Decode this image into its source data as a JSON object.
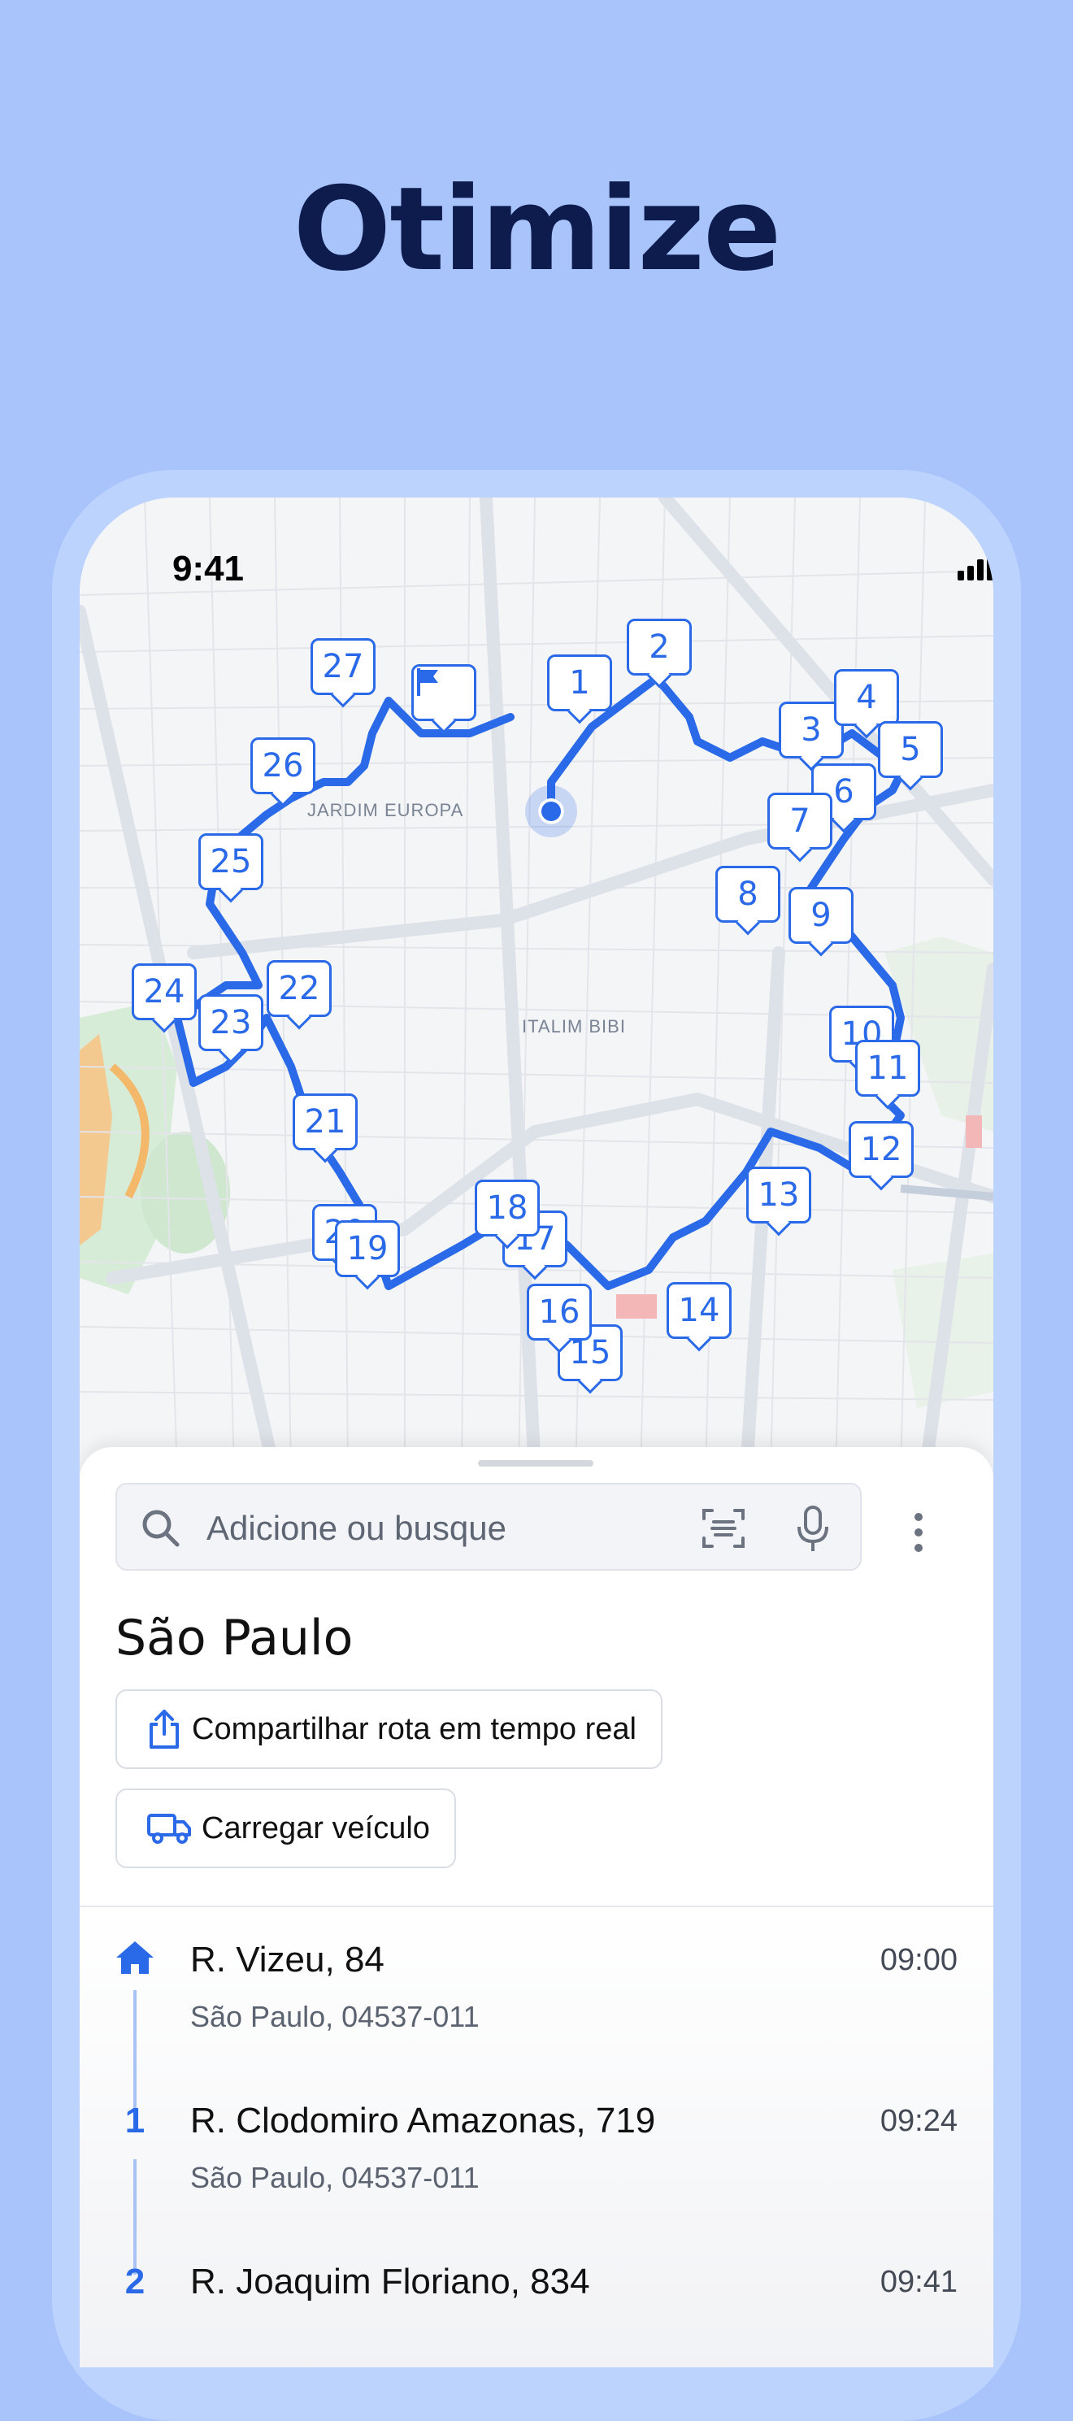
{
  "headline": "Otimize",
  "status_bar": {
    "time": "9:41"
  },
  "map": {
    "labels": {
      "neighborhood_1": "JARDIM EUROPA",
      "neighborhood_2": "ITALIM BIBI"
    },
    "pins": [
      "1",
      "2",
      "3",
      "4",
      "5",
      "6",
      "7",
      "8",
      "9",
      "10",
      "11",
      "12",
      "13",
      "14",
      "15",
      "16",
      "17",
      "18",
      "19",
      "20",
      "21",
      "22",
      "23",
      "24",
      "25",
      "26",
      "27"
    ],
    "route_color": "#2a6ae8",
    "end_icon": "flag-icon"
  },
  "search": {
    "placeholder": "Adicione ou busque"
  },
  "route": {
    "city": "São Paulo",
    "share_label": "Compartilhar rota em tempo real",
    "load_label": "Carregar veículo"
  },
  "stops": [
    {
      "marker": "home-icon",
      "title": "R. Vizeu, 84",
      "subtitle": "São Paulo, 04537-011",
      "time": "09:00"
    },
    {
      "marker": "1",
      "title": "R. Clodomiro Amazonas, 719",
      "subtitle": "São Paulo, 04537-011",
      "time": "09:24"
    },
    {
      "marker": "2",
      "title": "R. Joaquim Floriano, 834",
      "subtitle": "",
      "time": "09:41"
    }
  ],
  "colors": {
    "background": "#a8c4fb",
    "accent": "#2a6ae8",
    "headline": "#0d1b4d"
  }
}
